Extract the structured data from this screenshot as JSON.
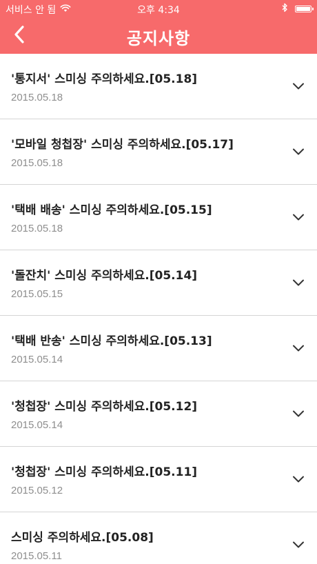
{
  "status_bar": {
    "carrier": "서비스 안 됨",
    "time": "오후 4:34",
    "wifi_icon": "wifi-icon",
    "bluetooth_icon": "bluetooth-icon",
    "battery_icon": "battery-icon",
    "battery_level": 1.0
  },
  "header": {
    "title": "공지사항",
    "back_icon": "chevron-left-icon",
    "background_color": "#f76a6b"
  },
  "notices": [
    {
      "title": "'통지서' 스미싱 주의하세요.[05.18]",
      "date": "2015.05.18"
    },
    {
      "title": "'모바일 청첩장' 스미싱 주의하세요.[05.17]",
      "date": "2015.05.18"
    },
    {
      "title": "'택배 배송' 스미싱 주의하세요.[05.15]",
      "date": "2015.05.18"
    },
    {
      "title": "'돌잔치' 스미싱 주의하세요.[05.14]",
      "date": "2015.05.15"
    },
    {
      "title": "'택배 반송' 스미싱 주의하세요.[05.13]",
      "date": "2015.05.14"
    },
    {
      "title": "'청첩장' 스미싱 주의하세요.[05.12]",
      "date": "2015.05.14"
    },
    {
      "title": "'청첩장' 스미싱 주의하세요.[05.11]",
      "date": "2015.05.12"
    },
    {
      "title": "스미싱 주의하세요.[05.08]",
      "date": "2015.05.11"
    }
  ],
  "expand_icon": "chevron-down-icon"
}
